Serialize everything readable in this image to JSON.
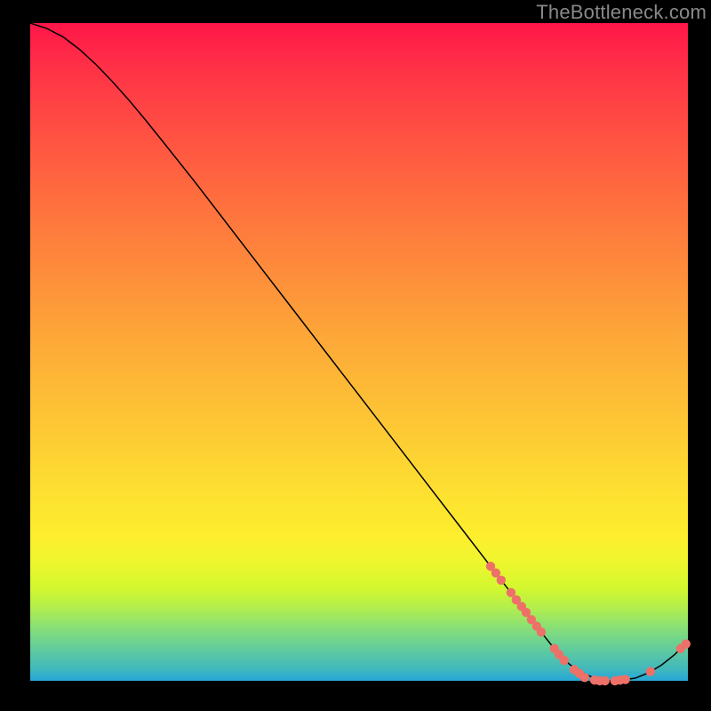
{
  "watermark": "TheBottleneck.com",
  "chart_data": {
    "type": "line",
    "title": "",
    "xlabel": "",
    "ylabel": "",
    "xlim": [
      0,
      100
    ],
    "ylim": [
      0,
      100
    ],
    "grid": false,
    "legend": false,
    "series": [
      {
        "name": "curve",
        "x": [
          0.0,
          2.5,
          5.0,
          7.5,
          10.0,
          12.5,
          15.0,
          17.5,
          20.0,
          25.0,
          30.0,
          35.0,
          40.0,
          45.0,
          50.0,
          55.0,
          60.0,
          65.0,
          70.0,
          72.0,
          74.0,
          76.0,
          78.0,
          80.0,
          82.0,
          84.0,
          86.0,
          88.0,
          90.0,
          92.0,
          94.0,
          96.0,
          98.0,
          100.0
        ],
        "y": [
          100.0,
          99.2,
          97.9,
          96.0,
          93.7,
          91.1,
          88.3,
          85.3,
          82.2,
          75.9,
          69.4,
          62.9,
          56.4,
          49.9,
          43.4,
          36.9,
          30.4,
          23.9,
          17.4,
          14.8,
          12.2,
          9.6,
          7.0,
          4.5,
          2.5,
          1.2,
          0.3,
          0.0,
          0.1,
          0.4,
          1.2,
          2.4,
          4.0,
          6.0
        ]
      }
    ],
    "markers": [
      {
        "x": 70.0,
        "y": 17.4
      },
      {
        "x": 70.8,
        "y": 16.4
      },
      {
        "x": 71.6,
        "y": 15.3
      },
      {
        "x": 73.1,
        "y": 13.4
      },
      {
        "x": 73.9,
        "y": 12.3
      },
      {
        "x": 74.7,
        "y": 11.3
      },
      {
        "x": 75.4,
        "y": 10.4
      },
      {
        "x": 76.2,
        "y": 9.3
      },
      {
        "x": 77.0,
        "y": 8.3
      },
      {
        "x": 77.7,
        "y": 7.4
      },
      {
        "x": 79.7,
        "y": 4.9
      },
      {
        "x": 80.4,
        "y": 4.0
      },
      {
        "x": 81.2,
        "y": 3.1
      },
      {
        "x": 82.7,
        "y": 1.7
      },
      {
        "x": 83.5,
        "y": 1.1
      },
      {
        "x": 84.3,
        "y": 0.5
      },
      {
        "x": 85.8,
        "y": 0.1
      },
      {
        "x": 86.6,
        "y": 0.0
      },
      {
        "x": 87.4,
        "y": 0.0
      },
      {
        "x": 88.9,
        "y": 0.0
      },
      {
        "x": 89.7,
        "y": 0.1
      },
      {
        "x": 90.5,
        "y": 0.2
      },
      {
        "x": 94.3,
        "y": 1.4
      },
      {
        "x": 98.9,
        "y": 4.9
      },
      {
        "x": 99.7,
        "y": 5.6
      }
    ],
    "colors": {
      "line": "#000000",
      "marker": "#ed7168",
      "bg_top": "#ff1649",
      "bg_bottom": "#28a7d6"
    }
  }
}
